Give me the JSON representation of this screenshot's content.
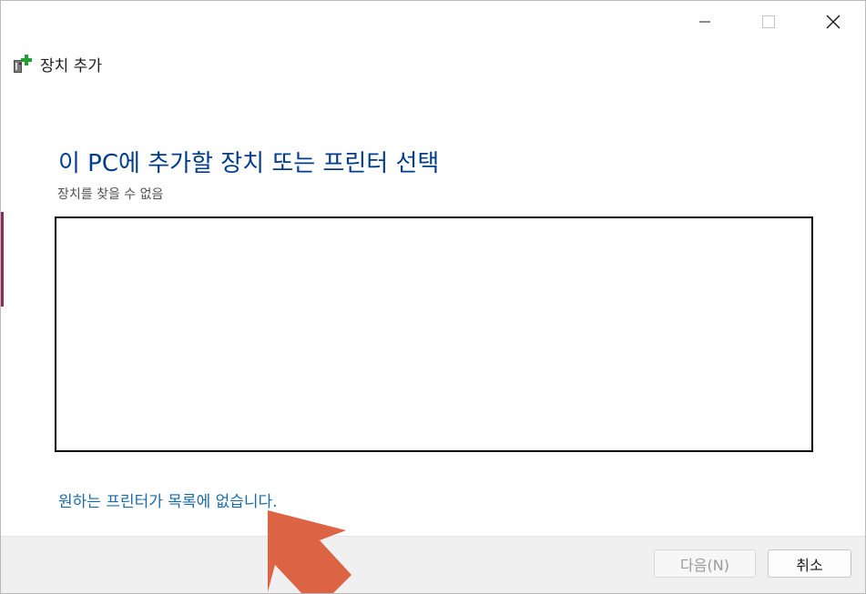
{
  "window": {
    "title": "장치 추가",
    "controls": [
      "minimize-icon",
      "maximize-icon",
      "close-icon"
    ]
  },
  "main": {
    "heading": "이 PC에 추가할 장치 또는 프린터 선택",
    "status": "장치를 찾을 수 없음",
    "device_list_items": [],
    "help_link": "원하는 프린터가 목록에 없습니다."
  },
  "footer": {
    "next_label": "다음(N)",
    "cancel_label": "취소"
  },
  "colors": {
    "heading": "#003c8c",
    "link": "#1a6aaa",
    "annotation_arrow": "#dc6444",
    "app_icon_plus": "#1fa030"
  },
  "icons": {
    "app": "add-device-icon",
    "annotation": "arrow-annotation-icon"
  }
}
